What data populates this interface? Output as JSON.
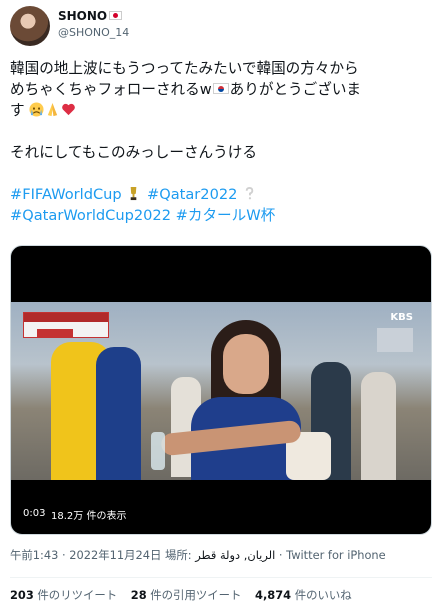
{
  "user": {
    "name": "SHONO",
    "handle": "@SHONO_14"
  },
  "tweet": {
    "line1": "韓国の地上波にもうつってたみたいで韓国の方々から",
    "line2_a": "めちゃくちゃフォローされるw",
    "line2_b": "ありがとうございま",
    "line3": "す",
    "line5": "それにしてもこのみっしーさんうける",
    "hashtags_line1": [
      "#FIFAWorldCup",
      "#Qatar2022"
    ],
    "hashtags_line2": [
      "#QatarWorldCup2022",
      "#カタールW杯"
    ]
  },
  "video": {
    "elapsed": "0:03",
    "views": "18.2万 件の表示",
    "broadcaster": "KBS"
  },
  "meta": {
    "time_date": "午前1:43 · 2022年11月24日",
    "place_label": "場所:",
    "place": "الريان, دولة قطر",
    "source": "· Twitter for iPhone"
  },
  "stats": {
    "retweets_count": "203",
    "retweets_label": "件のリツイート",
    "quotes_count": "28",
    "quotes_label": "件の引用ツイート",
    "likes_count": "4,874",
    "likes_label": "件のいいね"
  },
  "colors": {
    "link": "#1d9bf0",
    "text": "#0f1419",
    "secondary": "#536471"
  }
}
